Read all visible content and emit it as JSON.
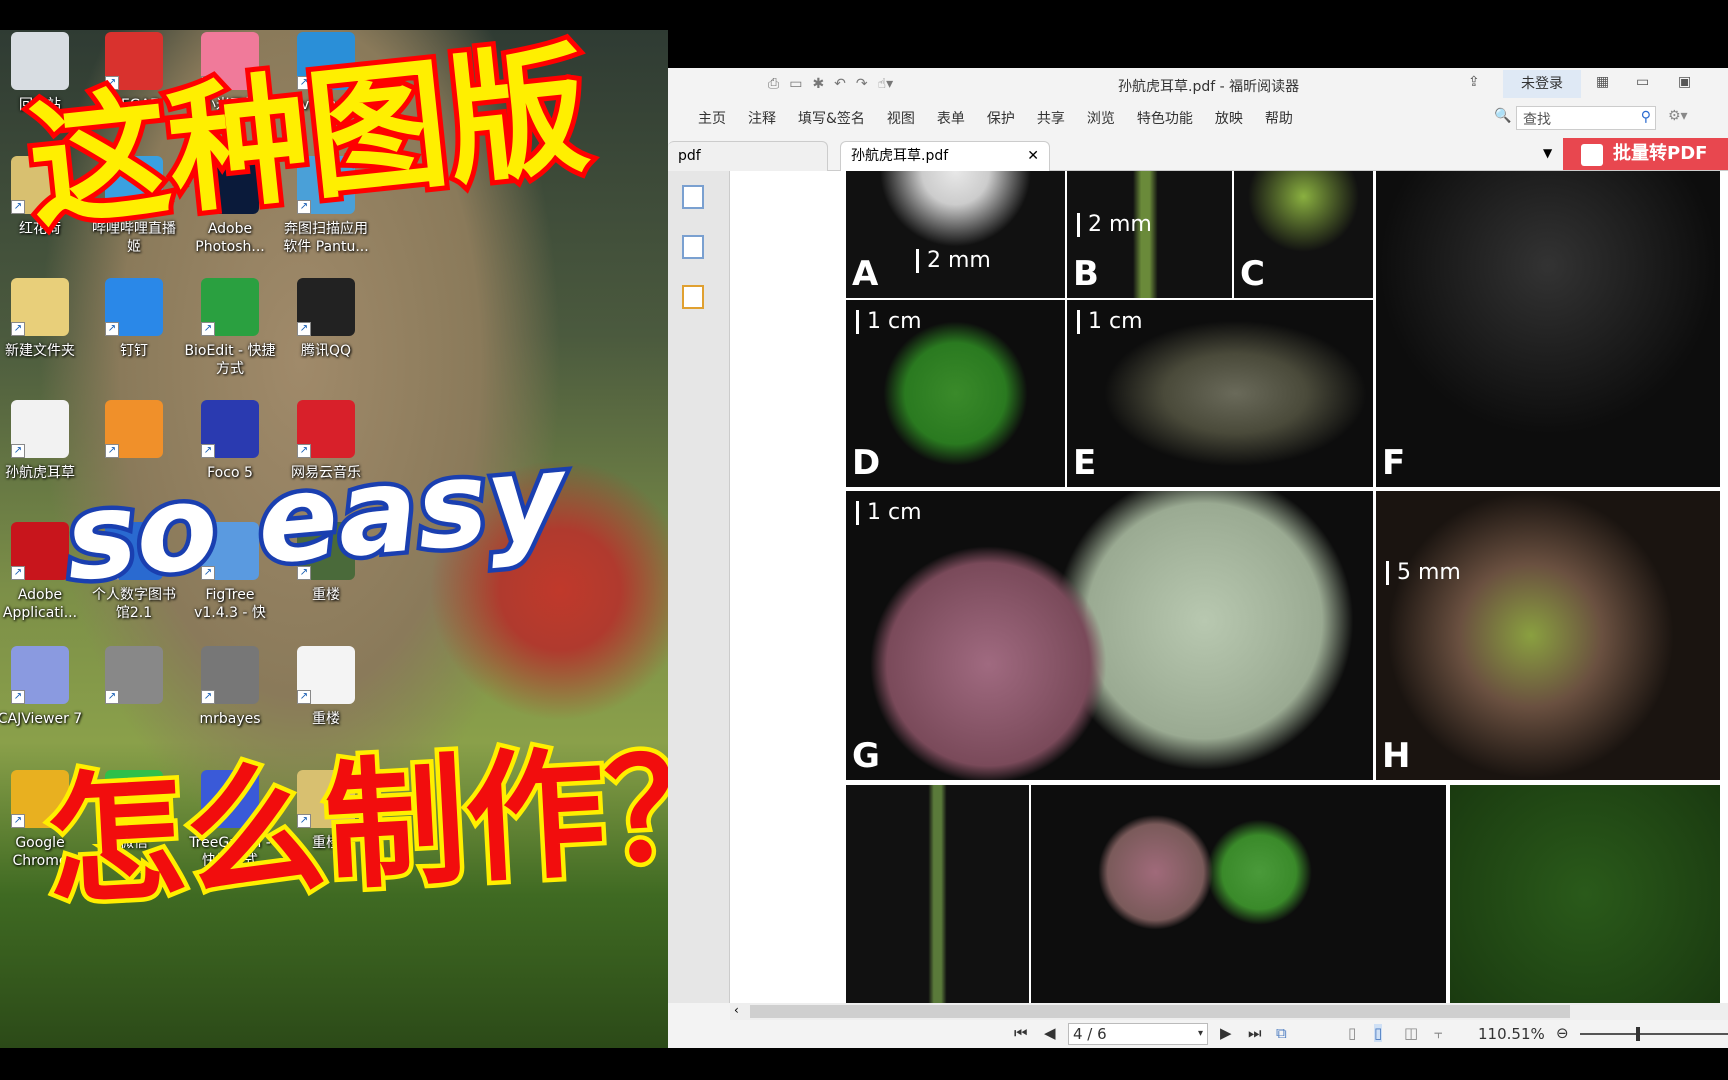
{
  "desktop": {
    "icons": [
      {
        "label": "回收站",
        "color": "#d8dde2"
      },
      {
        "label": "MEGA7",
        "color": "#d9322e"
      },
      {
        "label": "小米画报",
        "color": "#f07a9a"
      },
      {
        "label": "v2rayN",
        "color": "#2a8fd8"
      },
      {
        "label": "红花荷",
        "color": "#d8c070"
      },
      {
        "label": "哔哩哔哩直播姬",
        "color": "#3aa0e0"
      },
      {
        "label": "Adobe Photosh...",
        "color": "#0a1a3a"
      },
      {
        "label": "奔图扫描应用软件 Pantu...",
        "color": "#4aa0d8"
      },
      {
        "label": "新建文件夹",
        "color": "#e8cf7a"
      },
      {
        "label": "钉钉",
        "color": "#2a88e8"
      },
      {
        "label": "BioEdit - 快捷方式",
        "color": "#2aa040"
      },
      {
        "label": "腾讯QQ",
        "color": "#222"
      },
      {
        "label": "孙航虎耳草",
        "color": "#f2f2f2"
      },
      {
        "label": "",
        "color": "#f0902a"
      },
      {
        "label": "Foco 5",
        "color": "#2a3ab0"
      },
      {
        "label": "网易云音乐",
        "color": "#d8202a"
      },
      {
        "label": "Adobe Applicati...",
        "color": "#c8151c"
      },
      {
        "label": "个人数字图书馆2.1",
        "color": "#2a6ad0"
      },
      {
        "label": "FigTree v1.4.3 - 快",
        "color": "#5a9ae0"
      },
      {
        "label": "重楼",
        "color": "#4a6a3a"
      },
      {
        "label": "CAJViewer 7",
        "color": "#8a9ae0"
      },
      {
        "label": "",
        "color": "#888"
      },
      {
        "label": "mrbayes",
        "color": "#777"
      },
      {
        "label": "重楼",
        "color": "#f4f4f4"
      },
      {
        "label": "Google Chrome",
        "color": "#e8b020"
      },
      {
        "label": "微信",
        "color": "#2ec04a"
      },
      {
        "label": "TreeGraph - 快捷方式",
        "color": "#3a5ad8"
      },
      {
        "label": "重楼",
        "color": "#d8c070"
      }
    ]
  },
  "overlay": {
    "line1": "这种图版",
    "line2": "so easy",
    "line3": "怎么制作？"
  },
  "app": {
    "title": "孙航虎耳草.pdf - 福昕阅读器",
    "login": "未登录",
    "menu": [
      "主页",
      "注释",
      "填写&签名",
      "视图",
      "表单",
      "保护",
      "共享",
      "浏览",
      "特色功能",
      "放映",
      "帮助"
    ],
    "search_placeholder": "查找",
    "tabs": [
      {
        "label": "pdf"
      },
      {
        "label": "孙航虎耳草.pdf"
      }
    ],
    "convert_button": "批量转PDF",
    "status": {
      "page": "4 / 6",
      "zoom": "110.51%"
    }
  },
  "plate": {
    "panels": [
      {
        "label": "A",
        "scale": "2 mm"
      },
      {
        "label": "B",
        "scale": "2 mm"
      },
      {
        "label": "C",
        "scale": ""
      },
      {
        "label": "D",
        "scale": "1 cm"
      },
      {
        "label": "E",
        "scale": "1 cm"
      },
      {
        "label": "F",
        "scale": ""
      },
      {
        "label": "G",
        "scale": "1 cm"
      },
      {
        "label": "H",
        "scale": "5 mm"
      },
      {
        "label": "",
        "scale": ""
      },
      {
        "label": "",
        "scale": ""
      },
      {
        "label": "",
        "scale": ""
      }
    ]
  }
}
